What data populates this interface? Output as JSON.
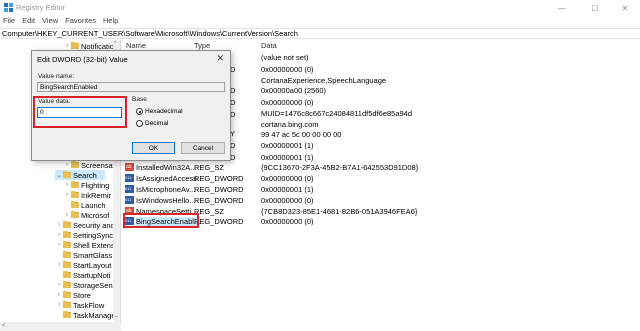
{
  "window": {
    "title": "Registry Editor",
    "minimize_glyph": "—",
    "maximize_glyph": "☐",
    "close_glyph": "✕"
  },
  "menu": [
    "File",
    "Edit",
    "View",
    "Favorites",
    "Help"
  ],
  "address": "Computer\\HKEY_CURRENT_USER\\Software\\Microsoft\\Windows\\CurrentVersion\\Search",
  "tree": {
    "items": [
      {
        "label": "Notification",
        "chev": "›"
      },
      {
        "label": "Screensaver",
        "chev": "›"
      },
      {
        "label": "Search",
        "chev": "⌄",
        "selected": true
      },
      {
        "label": "Flighting",
        "chev": "›"
      },
      {
        "label": "InkRemir",
        "chev": "›"
      },
      {
        "label": "Launch",
        "chev": ""
      },
      {
        "label": "Microsof",
        "chev": "›"
      },
      {
        "label": "Security and",
        "chev": "›"
      },
      {
        "label": "SettingSync",
        "chev": "›"
      },
      {
        "label": "Shell Extens",
        "chev": "›"
      },
      {
        "label": "SmartGlass",
        "chev": ""
      },
      {
        "label": "StartLayout",
        "chev": "›"
      },
      {
        "label": "StartupNoti",
        "chev": ""
      },
      {
        "label": "StorageSen",
        "chev": "›"
      },
      {
        "label": "Store",
        "chev": "›"
      },
      {
        "label": "TaskFlow",
        "chev": "›"
      },
      {
        "label": "TaskManage",
        "chev": ""
      }
    ],
    "scroll_up": "^",
    "scroll_down": "⌄",
    "hscroll_left": "<"
  },
  "list": {
    "headers": {
      "name": "Name",
      "type": "Type",
      "data": "Data"
    },
    "data_only_rows": [
      "(value not set)",
      "0x00000000 (0)",
      "CortanaExperience,SpeechLanguage",
      "0x00000a00 (2560)",
      "0x00000000 (0)",
      "MUID=1476c8c667c24084811df5df6e85a94d",
      "cortana.bing.com",
      "99 47 ac 5c 00 00 00 00",
      "0x00000001 (1)",
      "0x00000001 (1)"
    ],
    "partial_type_rows": [
      "D",
      "D",
      "D",
      "D",
      "Y",
      "D",
      "D"
    ],
    "rows": [
      {
        "icon": "string-value-icon",
        "kind": "sz",
        "name": "InstalledWin32A...",
        "type": "REG_SZ",
        "data": "{9CC13670-2F3A-45B2-B7A1-642553D91D08}"
      },
      {
        "icon": "dword-value-icon",
        "kind": "dword",
        "name": "IsAssignedAccess",
        "type": "REG_DWORD",
        "data": "0x00000000 (0)"
      },
      {
        "icon": "dword-value-icon",
        "kind": "dword",
        "name": "IsMicrophoneAv...",
        "type": "REG_DWORD",
        "data": "0x00000001 (1)"
      },
      {
        "icon": "dword-value-icon",
        "kind": "dword",
        "name": "IsWindowsHello...",
        "type": "REG_DWORD",
        "data": "0x00000000 (0)"
      },
      {
        "icon": "string-value-icon",
        "kind": "sz",
        "name": "NamespaceSetti...",
        "type": "REG_SZ",
        "data": "{7CB8D323-85E1-4681-82B6-051A3946FEA6}"
      },
      {
        "icon": "dword-value-icon",
        "kind": "dword",
        "name": "BingSearchEnabl...",
        "type": "REG_DWORD",
        "data": "0x00000000 (0)",
        "selected": true
      }
    ]
  },
  "dialog": {
    "title": "Edit DWORD (32-bit) Value",
    "close_glyph": "✕",
    "value_name_label": "Value name:",
    "value_name": "BingSearchEnabled",
    "value_data_label": "Value data:",
    "value_data": "0",
    "base_label": "Base",
    "base_options": [
      "Hexadecimal",
      "Decimal"
    ],
    "base_selected": "Hexadecimal",
    "ok_label": "OK",
    "cancel_label": "Cancel"
  },
  "colors": {
    "highlight_box": "#d9222a",
    "selection": "#cce8ff",
    "folder": "#e8bf57"
  }
}
